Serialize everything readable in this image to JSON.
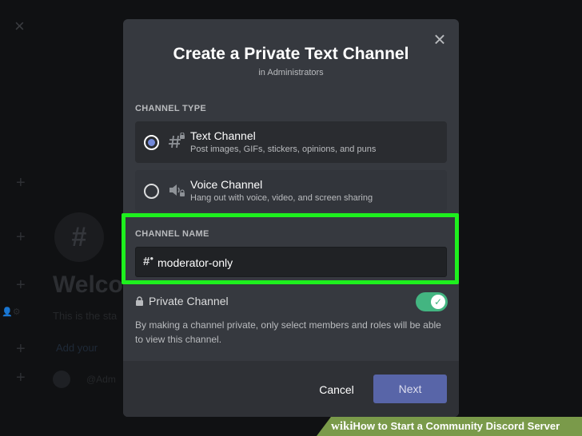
{
  "background": {
    "welcome_text": "Welco",
    "sub_text": "This is the sta",
    "link_text": "Add your",
    "mention_text": "@Adm"
  },
  "modal": {
    "title": "Create a Private Text Channel",
    "subtitle": "in Administrators",
    "channel_type_label": "CHANNEL TYPE",
    "options": [
      {
        "name": "Text Channel",
        "description": "Post images, GIFs, stickers, opinions, and puns",
        "selected": true,
        "icon": "hash-lock-icon"
      },
      {
        "name": "Voice Channel",
        "description": "Hang out with voice, video, and screen sharing",
        "selected": false,
        "icon": "speaker-lock-icon"
      }
    ],
    "channel_name_label": "CHANNEL NAME",
    "channel_name_value": "moderator-only",
    "private_label": "Private Channel",
    "private_enabled": true,
    "private_description": "By making a channel private, only select members and roles will be able to view this channel.",
    "cancel_label": "Cancel",
    "next_label": "Next"
  },
  "banner": {
    "brand": "wiki",
    "text": "How to Start a Community Discord Server"
  },
  "colors": {
    "highlight": "#1ef01e",
    "toggle_on": "#43b581",
    "next_button": "#5865a8",
    "radio_selected": "#7289da"
  }
}
